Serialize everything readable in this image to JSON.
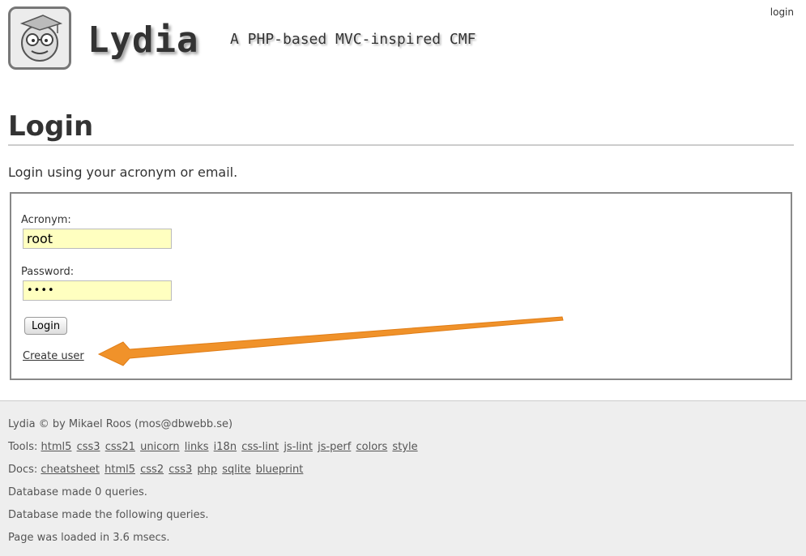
{
  "header": {
    "title": "Lydia",
    "slogan": "A PHP-based MVC-inspired CMF",
    "login_link": "login",
    "logo_icon": "smiley-graduate-logo-icon"
  },
  "main": {
    "heading": "Login",
    "intro": "Login using your acronym or email.",
    "form": {
      "acronym_label": "Acronym:",
      "acronym_value": "root",
      "password_label": "Password:",
      "password_value": "••••",
      "submit_label": "Login",
      "create_user_link": "Create user"
    }
  },
  "annotation": {
    "arrow_color": "#f0922a"
  },
  "footer": {
    "credit": "Lydia © by Mikael Roos (mos@dbwebb.se)",
    "tools_label": "Tools:",
    "tools": [
      "html5",
      "css3",
      "css21",
      "unicorn",
      "links",
      "i18n",
      "css-lint",
      "js-lint",
      "js-perf",
      "colors",
      "style"
    ],
    "docs_label": "Docs:",
    "docs": [
      "cheatsheet",
      "html5",
      "css2",
      "css3",
      "php",
      "sqlite",
      "blueprint"
    ],
    "db_count": "Database made 0 queries.",
    "db_list": "Database made the following queries.",
    "load_time": "Page was loaded in 3.6 msecs."
  }
}
